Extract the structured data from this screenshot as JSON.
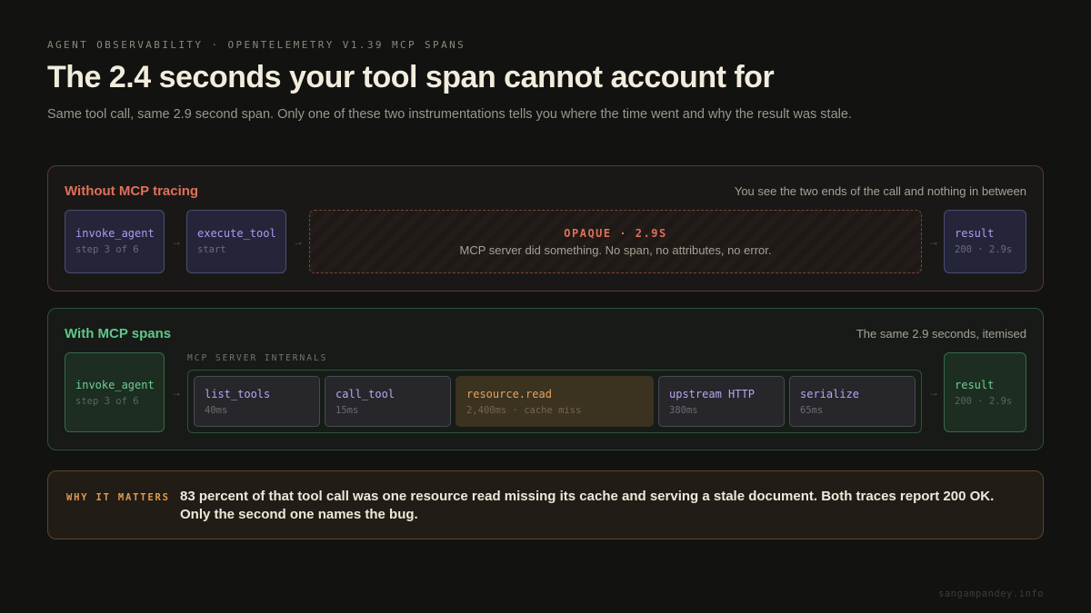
{
  "eyebrow": "AGENT OBSERVABILITY · OPENTELEMETRY V1.39 MCP SPANS",
  "title": "The 2.4 seconds your tool span cannot account for",
  "subtitle": "Same tool call, same 2.9 second span. Only one of these two instrumentations tells you where the time went and why the result was stale.",
  "without_panel": {
    "title": "Without MCP tracing",
    "note": "You see the two ends of the call and nothing in between",
    "nodes": [
      {
        "label": "invoke_agent",
        "sub": "step 3 of 6"
      },
      {
        "label": "execute_tool",
        "sub": "start"
      }
    ],
    "opaque": {
      "label": "OPAQUE · 2.9S",
      "description": "MCP server did something. No span, no attributes, no error."
    },
    "result": {
      "label": "result",
      "sub": "200 · 2.9s"
    }
  },
  "with_panel": {
    "title": "With MCP spans",
    "note": "The same 2.9 seconds, itemised",
    "agent": {
      "label": "invoke_agent",
      "sub": "step 3 of 6"
    },
    "internals_label": "MCP SERVER INTERNALS",
    "steps": [
      {
        "label": "list_tools",
        "sub": "40ms"
      },
      {
        "label": "call_tool",
        "sub": "15ms"
      },
      {
        "label": "resource.read",
        "sub": "2,400ms · cache miss"
      },
      {
        "label": "upstream HTTP",
        "sub": "380ms"
      },
      {
        "label": "serialize",
        "sub": "65ms"
      }
    ],
    "result": {
      "label": "result",
      "sub": "200 · 2.9s"
    }
  },
  "callout": {
    "tag": "WHY IT MATTERS",
    "text": "83 percent of that tool call was one resource read missing its cache and serving a stale document. Both traces report 200 OK. Only the second one names the bug."
  },
  "arrow_glyph": "→",
  "footer": "sangampandey.info",
  "colors": {
    "background": "#121211",
    "without_accent": "#e0705a",
    "with_accent": "#5fc88a",
    "span_purple": "#a99cf0",
    "hot_orange": "#e6a35a"
  }
}
